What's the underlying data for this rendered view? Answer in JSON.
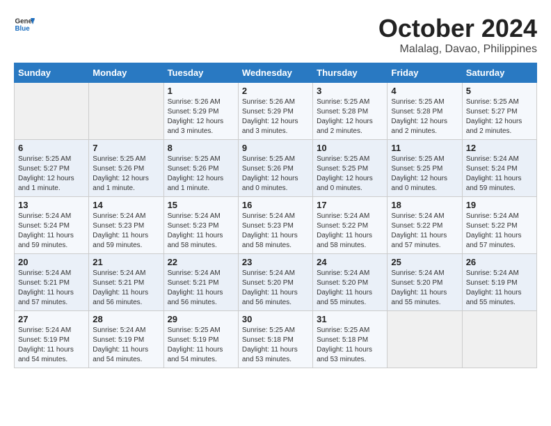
{
  "header": {
    "logo_line1": "General",
    "logo_line2": "Blue",
    "month": "October 2024",
    "location": "Malalag, Davao, Philippines"
  },
  "weekdays": [
    "Sunday",
    "Monday",
    "Tuesday",
    "Wednesday",
    "Thursday",
    "Friday",
    "Saturday"
  ],
  "weeks": [
    [
      {
        "day": "",
        "info": ""
      },
      {
        "day": "",
        "info": ""
      },
      {
        "day": "1",
        "info": "Sunrise: 5:26 AM\nSunset: 5:29 PM\nDaylight: 12 hours\nand 3 minutes."
      },
      {
        "day": "2",
        "info": "Sunrise: 5:26 AM\nSunset: 5:29 PM\nDaylight: 12 hours\nand 3 minutes."
      },
      {
        "day": "3",
        "info": "Sunrise: 5:25 AM\nSunset: 5:28 PM\nDaylight: 12 hours\nand 2 minutes."
      },
      {
        "day": "4",
        "info": "Sunrise: 5:25 AM\nSunset: 5:28 PM\nDaylight: 12 hours\nand 2 minutes."
      },
      {
        "day": "5",
        "info": "Sunrise: 5:25 AM\nSunset: 5:27 PM\nDaylight: 12 hours\nand 2 minutes."
      }
    ],
    [
      {
        "day": "6",
        "info": "Sunrise: 5:25 AM\nSunset: 5:27 PM\nDaylight: 12 hours\nand 1 minute."
      },
      {
        "day": "7",
        "info": "Sunrise: 5:25 AM\nSunset: 5:26 PM\nDaylight: 12 hours\nand 1 minute."
      },
      {
        "day": "8",
        "info": "Sunrise: 5:25 AM\nSunset: 5:26 PM\nDaylight: 12 hours\nand 1 minute."
      },
      {
        "day": "9",
        "info": "Sunrise: 5:25 AM\nSunset: 5:26 PM\nDaylight: 12 hours\nand 0 minutes."
      },
      {
        "day": "10",
        "info": "Sunrise: 5:25 AM\nSunset: 5:25 PM\nDaylight: 12 hours\nand 0 minutes."
      },
      {
        "day": "11",
        "info": "Sunrise: 5:25 AM\nSunset: 5:25 PM\nDaylight: 12 hours\nand 0 minutes."
      },
      {
        "day": "12",
        "info": "Sunrise: 5:24 AM\nSunset: 5:24 PM\nDaylight: 11 hours\nand 59 minutes."
      }
    ],
    [
      {
        "day": "13",
        "info": "Sunrise: 5:24 AM\nSunset: 5:24 PM\nDaylight: 11 hours\nand 59 minutes."
      },
      {
        "day": "14",
        "info": "Sunrise: 5:24 AM\nSunset: 5:23 PM\nDaylight: 11 hours\nand 59 minutes."
      },
      {
        "day": "15",
        "info": "Sunrise: 5:24 AM\nSunset: 5:23 PM\nDaylight: 11 hours\nand 58 minutes."
      },
      {
        "day": "16",
        "info": "Sunrise: 5:24 AM\nSunset: 5:23 PM\nDaylight: 11 hours\nand 58 minutes."
      },
      {
        "day": "17",
        "info": "Sunrise: 5:24 AM\nSunset: 5:22 PM\nDaylight: 11 hours\nand 58 minutes."
      },
      {
        "day": "18",
        "info": "Sunrise: 5:24 AM\nSunset: 5:22 PM\nDaylight: 11 hours\nand 57 minutes."
      },
      {
        "day": "19",
        "info": "Sunrise: 5:24 AM\nSunset: 5:22 PM\nDaylight: 11 hours\nand 57 minutes."
      }
    ],
    [
      {
        "day": "20",
        "info": "Sunrise: 5:24 AM\nSunset: 5:21 PM\nDaylight: 11 hours\nand 57 minutes."
      },
      {
        "day": "21",
        "info": "Sunrise: 5:24 AM\nSunset: 5:21 PM\nDaylight: 11 hours\nand 56 minutes."
      },
      {
        "day": "22",
        "info": "Sunrise: 5:24 AM\nSunset: 5:21 PM\nDaylight: 11 hours\nand 56 minutes."
      },
      {
        "day": "23",
        "info": "Sunrise: 5:24 AM\nSunset: 5:20 PM\nDaylight: 11 hours\nand 56 minutes."
      },
      {
        "day": "24",
        "info": "Sunrise: 5:24 AM\nSunset: 5:20 PM\nDaylight: 11 hours\nand 55 minutes."
      },
      {
        "day": "25",
        "info": "Sunrise: 5:24 AM\nSunset: 5:20 PM\nDaylight: 11 hours\nand 55 minutes."
      },
      {
        "day": "26",
        "info": "Sunrise: 5:24 AM\nSunset: 5:19 PM\nDaylight: 11 hours\nand 55 minutes."
      }
    ],
    [
      {
        "day": "27",
        "info": "Sunrise: 5:24 AM\nSunset: 5:19 PM\nDaylight: 11 hours\nand 54 minutes."
      },
      {
        "day": "28",
        "info": "Sunrise: 5:24 AM\nSunset: 5:19 PM\nDaylight: 11 hours\nand 54 minutes."
      },
      {
        "day": "29",
        "info": "Sunrise: 5:25 AM\nSunset: 5:19 PM\nDaylight: 11 hours\nand 54 minutes."
      },
      {
        "day": "30",
        "info": "Sunrise: 5:25 AM\nSunset: 5:18 PM\nDaylight: 11 hours\nand 53 minutes."
      },
      {
        "day": "31",
        "info": "Sunrise: 5:25 AM\nSunset: 5:18 PM\nDaylight: 11 hours\nand 53 minutes."
      },
      {
        "day": "",
        "info": ""
      },
      {
        "day": "",
        "info": ""
      }
    ]
  ]
}
